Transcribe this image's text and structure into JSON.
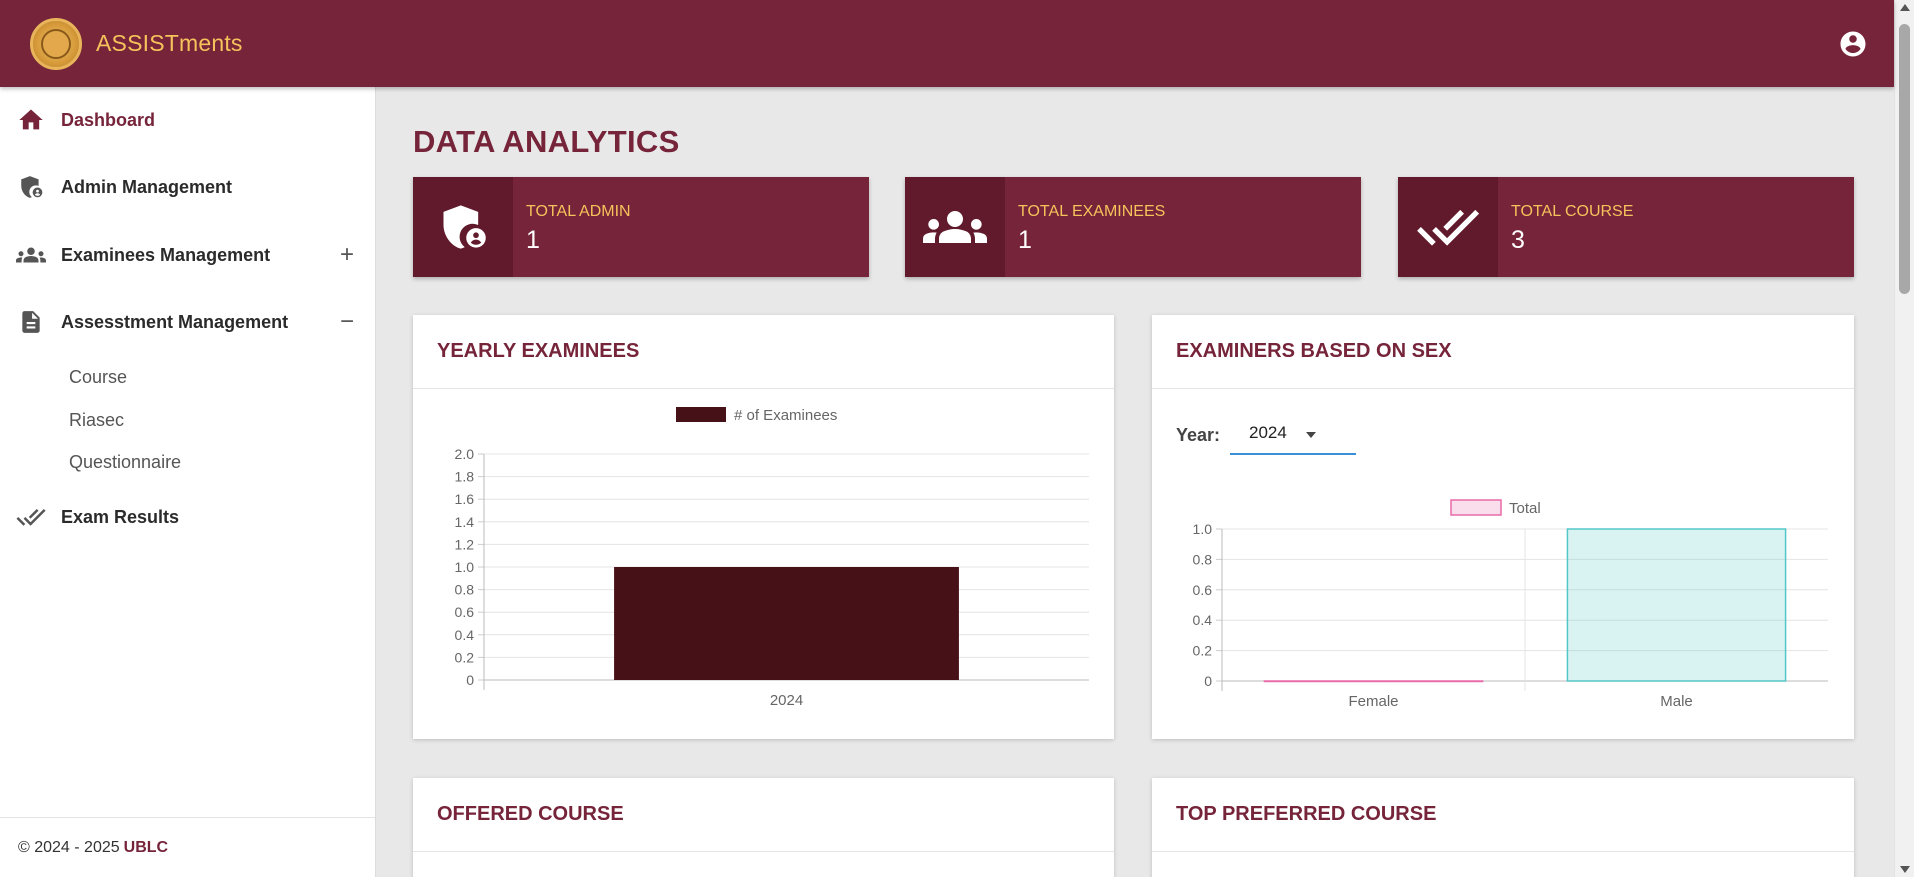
{
  "header": {
    "brand": "ASSISTments",
    "logo_icon": "seal-logo-icon",
    "account_icon": "account-circle-icon",
    "color": "#76243a",
    "accent": "#f6c25b"
  },
  "sidebar": {
    "items": [
      {
        "label": "Dashboard",
        "icon": "home-icon",
        "active": true
      },
      {
        "label": "Admin Management",
        "icon": "admin-shield-icon"
      },
      {
        "label": "Examinees Management",
        "icon": "group-icon",
        "toggle": "+"
      },
      {
        "label": "Assesstment Management",
        "icon": "document-icon",
        "toggle": "−"
      },
      {
        "label": "Exam Results",
        "icon": "double-check-icon"
      }
    ],
    "subitems": [
      "Course",
      "Riasec",
      "Questionnaire"
    ],
    "footer": {
      "text": "© 2024 - 2025",
      "org": "UBLC"
    }
  },
  "main": {
    "title": "DATA ANALYTICS",
    "stats": [
      {
        "label": "TOTAL ADMIN",
        "value": "1",
        "icon": "admin-shield-icon"
      },
      {
        "label": "TOTAL EXAMINEES",
        "value": "1",
        "icon": "group-icon"
      },
      {
        "label": "TOTAL COURSE",
        "value": "3",
        "icon": "double-check-icon"
      }
    ],
    "cards": {
      "yearly": "YEARLY EXAMINEES",
      "sex": "EXAMINERS BASED ON SEX",
      "offered": "OFFERED COURSE",
      "preferred": "TOP PREFERRED COURSE"
    },
    "year_filter": {
      "label": "Year:",
      "value": "2024"
    }
  },
  "chart_data": [
    {
      "type": "bar",
      "categories": [
        "2024"
      ],
      "series": [
        {
          "name": "# of Examinees",
          "values": [
            1
          ],
          "color": "#461217"
        }
      ],
      "ylim": [
        0,
        2
      ],
      "yticks": [
        "0",
        "0.2",
        "0.4",
        "0.6",
        "0.8",
        "1.0",
        "1.2",
        "1.4",
        "1.6",
        "1.8",
        "2.0"
      ],
      "legend": "top",
      "grid": true
    },
    {
      "type": "bar",
      "categories": [
        "Female",
        "Male"
      ],
      "series": [
        {
          "name": "Total",
          "values": [
            0,
            1
          ],
          "colors": [
            "#e86aa8",
            "#52c7c7"
          ]
        }
      ],
      "ylim": [
        0,
        1
      ],
      "yticks": [
        "0",
        "0.2",
        "0.4",
        "0.6",
        "0.8",
        "1.0"
      ],
      "legend": "top",
      "grid": true
    }
  ]
}
